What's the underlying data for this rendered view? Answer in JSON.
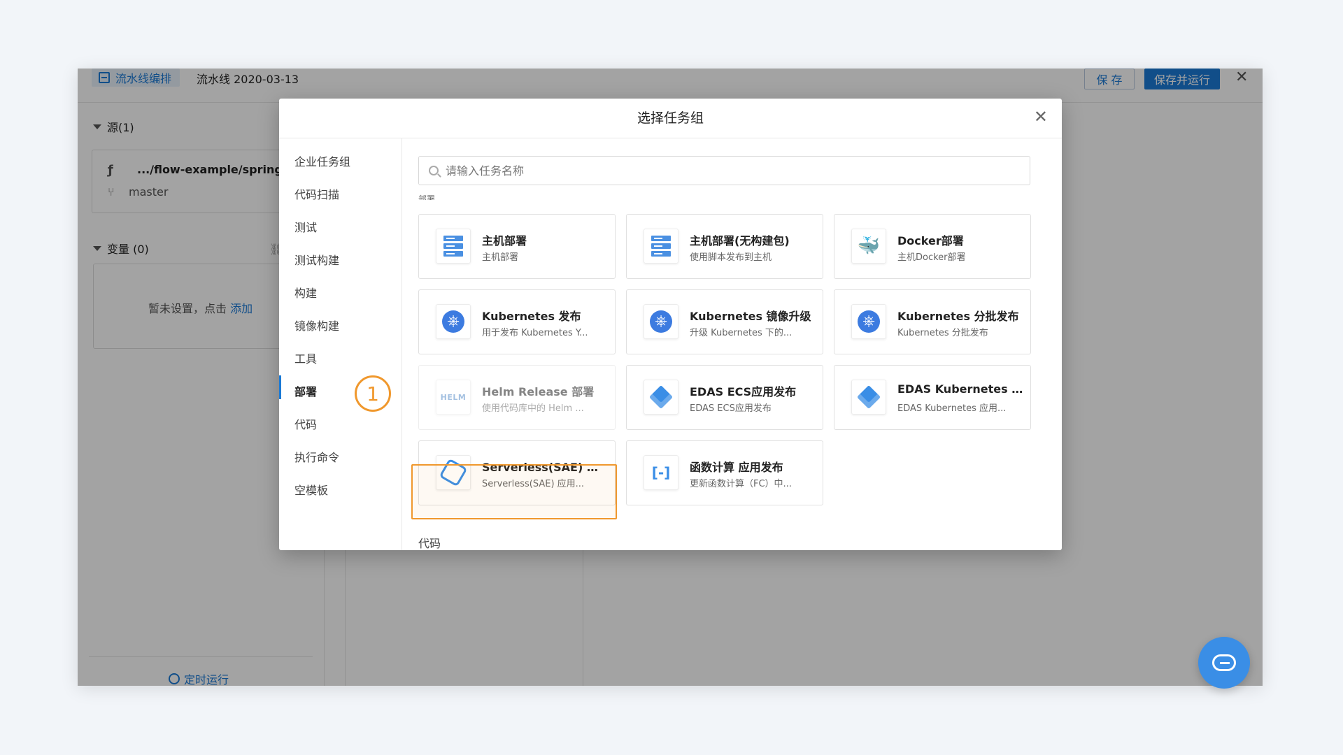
{
  "app": {
    "tab_label": "流水线编排",
    "pipeline_title": "流水线 2020-03-13",
    "save_label": "保 存",
    "save_run_label": "保存并运行",
    "close_glyph": "✕"
  },
  "left_panel": {
    "source_header": "源(1)",
    "source_path": ".../flow-example/spring-b",
    "source_branch": "master",
    "variables_header": "变量 (0)",
    "variables_empty": "暂未设置，点击",
    "variables_add_link": "添加",
    "timer_label": "定时运行"
  },
  "modal": {
    "title": "选择任务组",
    "close_glyph": "✕",
    "search_placeholder": "请输入任务名称",
    "nav_items": [
      {
        "label": "企业任务组"
      },
      {
        "label": "代码扫描"
      },
      {
        "label": "测试"
      },
      {
        "label": "测试构建"
      },
      {
        "label": "构建"
      },
      {
        "label": "镜像构建"
      },
      {
        "label": "工具"
      },
      {
        "label": "部署"
      },
      {
        "label": "代码"
      },
      {
        "label": "执行命令"
      },
      {
        "label": "空模板"
      }
    ],
    "active_nav": "部署",
    "clipped_section_label": "部署",
    "step_badge": "1",
    "cards": [
      {
        "title": "主机部署",
        "desc": "主机部署",
        "icon": "server-icon"
      },
      {
        "title": "主机部署(无构建包)",
        "desc": "使用脚本发布到主机",
        "icon": "server-icon"
      },
      {
        "title": "Docker部署",
        "desc": "主机Docker部署",
        "icon": "docker-icon"
      },
      {
        "title": "Kubernetes 发布",
        "desc": "用于发布 Kubernetes Y...",
        "icon": "kubernetes-icon"
      },
      {
        "title": "Kubernetes 镜像升级",
        "desc": "升级 Kubernetes 下的...",
        "icon": "kubernetes-icon"
      },
      {
        "title": "Kubernetes 分批发布",
        "desc": "Kubernetes 分批发布",
        "icon": "kubernetes-icon"
      },
      {
        "title": "Helm Release 部署",
        "desc": "使用代码库中的 Helm ...",
        "icon": "helm-icon",
        "icon_text": "HELM"
      },
      {
        "title": "EDAS ECS应用发布",
        "desc": "EDAS ECS应用发布",
        "icon": "edas-cube-icon"
      },
      {
        "title": "EDAS Kubernetes ...",
        "desc": "EDAS Kubernetes 应用...",
        "icon": "edas-cube-icon"
      },
      {
        "title": "Serverless(SAE) 应...",
        "desc": "Serverless(SAE) 应用...",
        "icon": "sae-icon"
      },
      {
        "title": "函数计算 应用发布",
        "desc": "更新函数计算（FC）中...",
        "icon": "function-compute-icon",
        "icon_text": "[-]"
      }
    ],
    "next_section_label": "代码"
  },
  "colors": {
    "accent": "#1b7ad6",
    "highlight": "#f0982d"
  }
}
